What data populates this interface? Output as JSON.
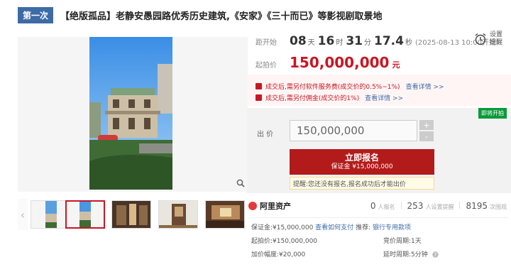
{
  "title": {
    "round_badge": "第一次",
    "text": "【绝版孤品】老静安愚园路优秀历史建筑,《安家》《三十而已》等影视剧取景地"
  },
  "countdown": {
    "label": "距开始",
    "days": "08",
    "days_unit": "天",
    "hours": "16",
    "hours_unit": "时",
    "minutes": "31",
    "minutes_unit": "分",
    "seconds": "17.4",
    "seconds_unit": "秒",
    "start_note": "(2025-08-13 10:00开始)"
  },
  "remind": {
    "label_line1": "设置",
    "label_line2": "提醒",
    "icon": "alarm-clock-icon"
  },
  "start_price": {
    "label": "起拍价",
    "value": "150,000,000",
    "unit": "元"
  },
  "notices": [
    {
      "text": "成交后,需另付软件服务费(成交价的0.5%~1%)",
      "link": "查看详情 >>"
    },
    {
      "text": "成交后,需另付佣金(成交价的1%)",
      "link": "查看详情 >>"
    }
  ],
  "bid": {
    "hot_tag": "即将开拍",
    "label": "出 价",
    "input_value": "150,000,000",
    "plus": "+",
    "minus": "-",
    "signup_main": "立即报名",
    "signup_sub": "保证金 ¥15,000,000",
    "tip": "提醒:您还没有报名,报名成功后才能出价"
  },
  "platform": {
    "name": "阿里资产",
    "signups": "0",
    "signups_label": "人报名",
    "reminders": "253",
    "reminders_label": "人设置提醒",
    "views": "8195",
    "views_label": "次围观"
  },
  "details": {
    "deposit": "保证金:¥15,000,000",
    "deposit_link": "查看如何支付",
    "recommend_label": "推荐:",
    "recommend_link": "银行专用款项",
    "start_price": "起拍价:¥150,000,000",
    "bid_period": "竞价周期:1天",
    "increment": "加价幅度:¥20,000",
    "delay_period": "延时周期:5分钟"
  },
  "colors": {
    "accent_red": "#c81623",
    "badge_blue": "#3d6ba6",
    "hot_green": "#0a9a3a"
  }
}
